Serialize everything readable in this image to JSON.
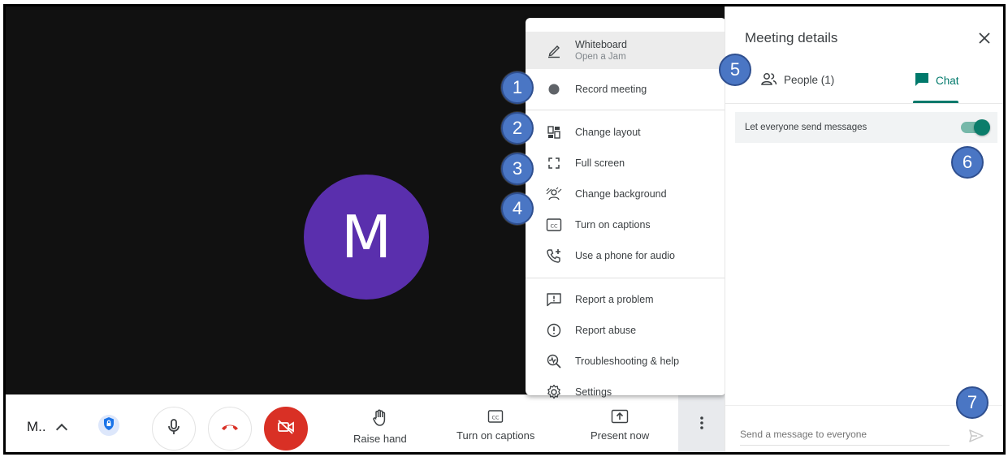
{
  "participant": {
    "initial": "M"
  },
  "bottom_bar": {
    "name": "M..",
    "raise_hand_label": "Raise hand",
    "captions_label": "Turn on captions",
    "present_label": "Present now"
  },
  "menu": {
    "items": [
      {
        "label": "Whiteboard",
        "sublabel": "Open a Jam",
        "icon": "pen-icon"
      },
      {
        "label": "Record meeting",
        "icon": "record-icon"
      },
      {
        "label": "Change layout",
        "icon": "layout-icon"
      },
      {
        "label": "Full screen",
        "icon": "fullscreen-icon"
      },
      {
        "label": "Change background",
        "icon": "background-icon"
      },
      {
        "label": "Turn on captions",
        "icon": "captions-icon"
      },
      {
        "label": "Use a phone for audio",
        "icon": "phone-icon"
      },
      {
        "label": "Report a problem",
        "icon": "report-problem-icon"
      },
      {
        "label": "Report abuse",
        "icon": "report-abuse-icon"
      },
      {
        "label": "Troubleshooting & help",
        "icon": "troubleshoot-icon"
      },
      {
        "label": "Settings",
        "icon": "settings-icon"
      }
    ]
  },
  "panel": {
    "title": "Meeting details",
    "tabs": [
      {
        "label": "People (1)"
      },
      {
        "label": "Chat"
      }
    ],
    "let_everyone_send_label": "Let everyone send messages",
    "let_everyone_send_enabled": true,
    "send_placeholder": "Send a message to everyone"
  },
  "callouts": [
    "1",
    "2",
    "3",
    "4",
    "5",
    "6",
    "7"
  ],
  "colors": {
    "accent": "#00796b",
    "callout": "#4a76c4",
    "avatar": "#5a2fad",
    "end_call": "#d93025"
  }
}
